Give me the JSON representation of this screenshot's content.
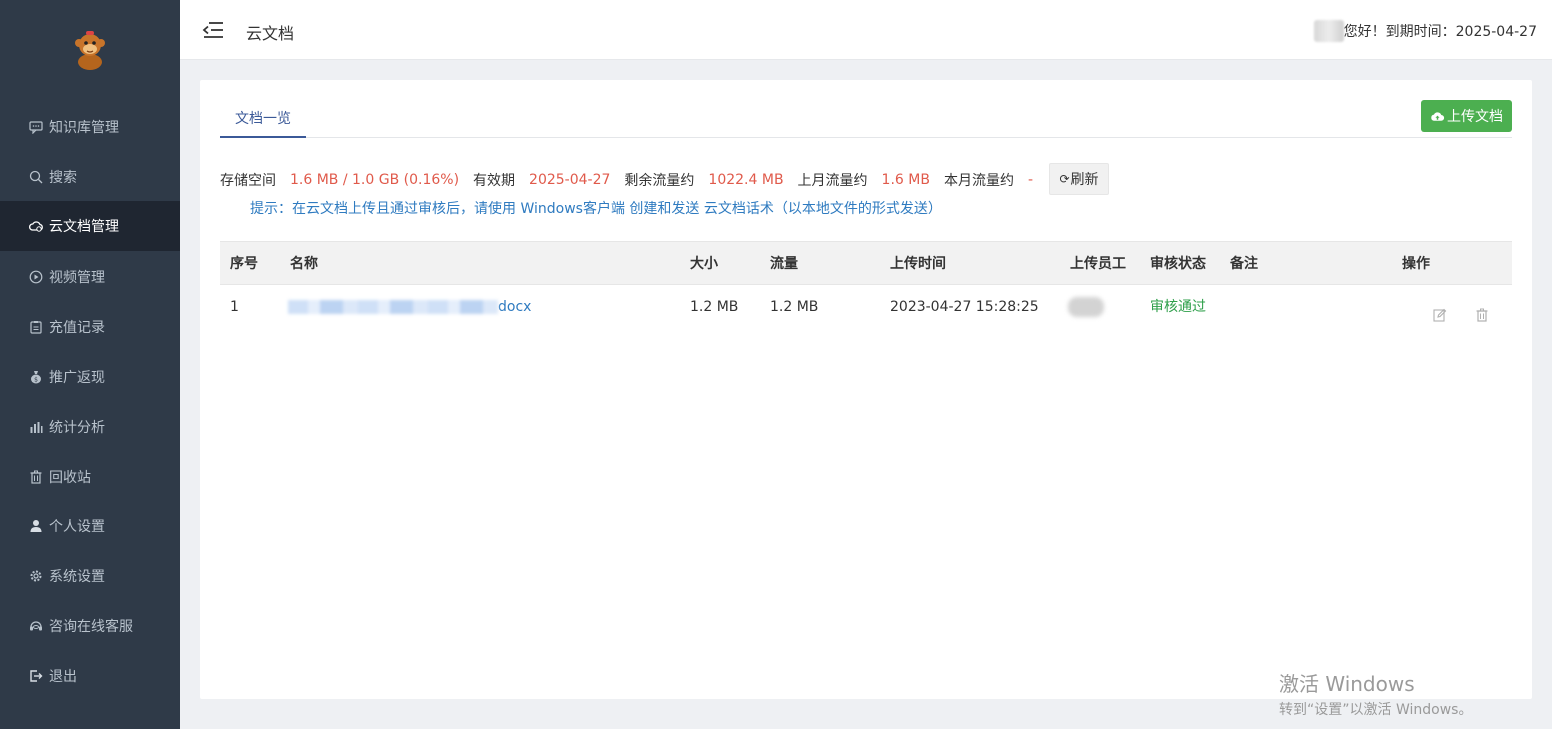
{
  "sidebar": {
    "items": [
      {
        "label": "知识库管理",
        "icon": "chat-icon"
      },
      {
        "label": "搜索",
        "icon": "search-icon"
      },
      {
        "label": "云文档管理",
        "icon": "cloud-icon",
        "active": true
      },
      {
        "label": "视频管理",
        "icon": "play-icon"
      },
      {
        "label": "充值记录",
        "icon": "clipboard-icon"
      },
      {
        "label": "推广返现",
        "icon": "money-bag-icon"
      },
      {
        "label": "统计分析",
        "icon": "bar-chart-icon"
      },
      {
        "label": "回收站",
        "icon": "trash-icon"
      },
      {
        "label": "个人设置",
        "icon": "user-icon"
      },
      {
        "label": "系统设置",
        "icon": "gear-icon"
      },
      {
        "label": "咨询在线客服",
        "icon": "headset-icon"
      },
      {
        "label": "退出",
        "icon": "logout-icon"
      }
    ]
  },
  "header": {
    "title": "云文档",
    "greeting": "您好！到期时间：2025-04-27"
  },
  "tabs": [
    {
      "label": "文档一览"
    }
  ],
  "upload_button": "上传文档",
  "stats": {
    "storage_label": "存储空间",
    "storage_value": "1.6 MB / 1.0 GB (0.16%)",
    "expiry_label": "有效期",
    "expiry_value": "2025-04-27",
    "remaining_label": "剩余流量约",
    "remaining_value": "1022.4 MB",
    "last_month_label": "上月流量约",
    "last_month_value": "1.6 MB",
    "this_month_label": "本月流量约",
    "this_month_value": "-"
  },
  "refresh_button": "刷新",
  "hint": "提示：在云文档上传且通过审核后，请使用 Windows客户端 创建和发送 云文档话术（以本地文件的形式发送）",
  "table": {
    "headers": [
      "序号",
      "名称",
      "大小",
      "流量",
      "上传时间",
      "上传员工",
      "审核状态",
      "备注",
      "操作"
    ],
    "rows": [
      {
        "index": "1",
        "name_suffix": "docx",
        "size": "1.2 MB",
        "traffic": "1.2 MB",
        "upload_time": "2023-04-27 15:28:25",
        "status": "审核通过",
        "note": ""
      }
    ]
  },
  "watermark": {
    "line1": "激活 Windows",
    "line2": "转到“设置”以激活 Windows。"
  },
  "colors": {
    "sidebar_bg": "#2f3a48",
    "sidebar_active": "#1f2631",
    "accent_red": "#e05a4b",
    "link_blue": "#2f7bc0",
    "upload_green": "#4caf50",
    "status_green": "#2e9f4a"
  }
}
